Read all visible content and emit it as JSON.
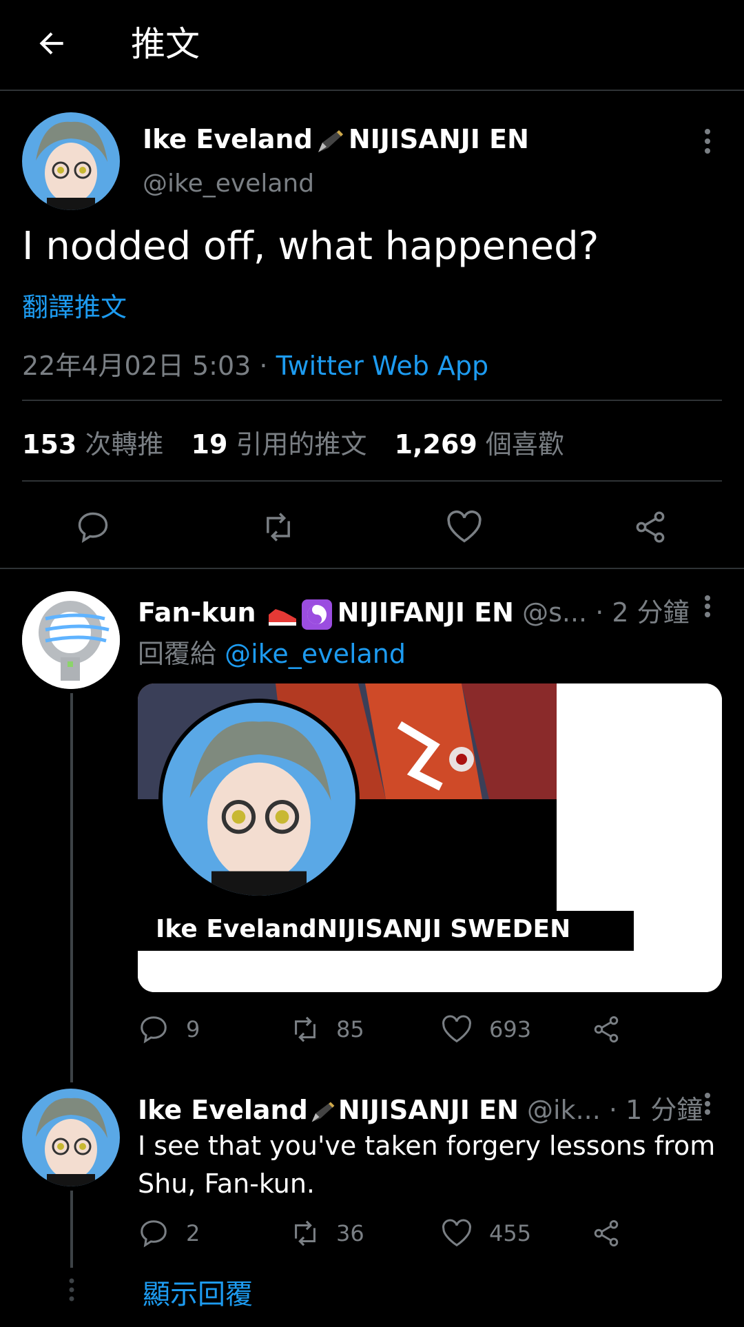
{
  "header": {
    "title": "推文"
  },
  "main_tweet": {
    "author_name": "Ike Eveland",
    "author_org": "NIJISANJI EN",
    "author_handle": "@ike_eveland",
    "text": "I nodded off, what happened?",
    "translate_label": "翻譯推文",
    "timestamp": "22年4月02日 5:03 ·",
    "source": "Twitter Web App",
    "stats": {
      "retweets_count": "153",
      "retweets_label": "次轉推",
      "quotes_count": "19",
      "quotes_label": "引用的推文",
      "likes_count": "1,269",
      "likes_label": "個喜歡"
    }
  },
  "reply1": {
    "author_name": "Fan-kun",
    "author_org": "NIJIFANJI EN",
    "author_handle": "@s...",
    "time": "· 2 分鐘",
    "replying_to_label": "回覆給",
    "replying_to_handle": "@ike_eveland",
    "image_caption": "Ike EvelandNIJISANJI SWEDEN",
    "replies": "9",
    "retweets": "85",
    "likes": "693"
  },
  "reply2": {
    "author_name": "Ike Eveland",
    "author_org": "NIJISANJI EN",
    "author_handle": "@ik...",
    "time": "· 1 分鐘",
    "text_line1": "I see that you've taken forgery lessons from",
    "text_line2": "Shu, Fan-kun.",
    "replies": "2",
    "retweets": "36",
    "likes": "455"
  },
  "show_replies_label": "顯示回覆",
  "colors": {
    "accent": "#1d9bf0",
    "background": "#000000",
    "muted": "#7a7f84",
    "border": "#2f3336"
  }
}
